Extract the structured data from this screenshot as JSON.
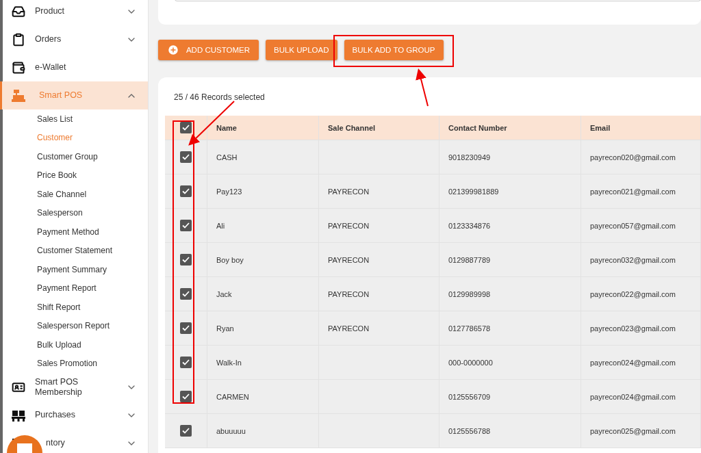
{
  "sidebar": {
    "items": [
      {
        "label": "Product",
        "kind": "group",
        "expanded": false,
        "selected": false
      },
      {
        "label": "Orders",
        "kind": "group",
        "expanded": false,
        "selected": false
      },
      {
        "label": "e-Wallet",
        "kind": "link",
        "selected": false
      },
      {
        "label": "Smart POS",
        "kind": "group",
        "expanded": true,
        "selected": true,
        "children": [
          {
            "label": "Sales List",
            "selected": false
          },
          {
            "label": "Customer",
            "selected": true
          },
          {
            "label": "Customer Group",
            "selected": false
          },
          {
            "label": "Price Book",
            "selected": false
          },
          {
            "label": "Sale Channel",
            "selected": false
          },
          {
            "label": "Salesperson",
            "selected": false
          },
          {
            "label": "Payment Method",
            "selected": false
          },
          {
            "label": "Customer Statement",
            "selected": false
          },
          {
            "label": "Payment Summary",
            "selected": false
          },
          {
            "label": "Payment Report",
            "selected": false
          },
          {
            "label": "Shift Report",
            "selected": false
          },
          {
            "label": "Salesperson Report",
            "selected": false
          },
          {
            "label": "Bulk Upload",
            "selected": false
          },
          {
            "label": "Sales Promotion",
            "selected": false
          }
        ]
      },
      {
        "label": "Smart POS\nMembership",
        "kind": "group",
        "expanded": false,
        "selected": false
      },
      {
        "label": "Purchases",
        "kind": "group",
        "expanded": false,
        "selected": false
      },
      {
        "label": "ntory",
        "kind": "group",
        "expanded": false,
        "selected": false
      }
    ]
  },
  "actions": [
    {
      "label": "ADD CUSTOMER",
      "kind": "add"
    },
    {
      "label": "BULK UPLOAD",
      "kind": "plain"
    },
    {
      "label": "BULK ADD TO GROUP",
      "kind": "plain"
    }
  ],
  "table": {
    "selection_summary": "25 / 46 Records selected",
    "all_checked": true,
    "columns": [
      "Name",
      "Sale Channel",
      "Contact Number",
      "Email"
    ],
    "rows": [
      {
        "checked": true,
        "cells": [
          "CASH",
          "",
          "9018230949",
          "payrecon020@gmail.com"
        ]
      },
      {
        "checked": true,
        "cells": [
          "Pay123",
          "PAYRECON",
          "021399981889",
          "payrecon021@gmail.com"
        ]
      },
      {
        "checked": true,
        "cells": [
          "Ali",
          "PAYRECON",
          "0123334876",
          "payrecon057@gmail.com"
        ]
      },
      {
        "checked": true,
        "cells": [
          "Boy boy",
          "PAYRECON",
          "0129887789",
          "payrecon032@gmail.com"
        ]
      },
      {
        "checked": true,
        "cells": [
          "Jack",
          "PAYRECON",
          "0129989998",
          "payrecon022@gmail.com"
        ]
      },
      {
        "checked": true,
        "cells": [
          "Ryan",
          "PAYRECON",
          "0127786578",
          "payrecon023@gmail.com"
        ]
      },
      {
        "checked": true,
        "cells": [
          "Walk-In",
          "",
          "000-0000000",
          "payrecon024@gmail.com"
        ]
      },
      {
        "checked": true,
        "cells": [
          "CARMEN",
          "",
          "0125556709",
          "payrecon024@gmail.com"
        ]
      },
      {
        "checked": true,
        "cells": [
          "abuuuuu",
          "",
          "0125556788",
          "payrecon025@gmail.com"
        ]
      }
    ]
  }
}
